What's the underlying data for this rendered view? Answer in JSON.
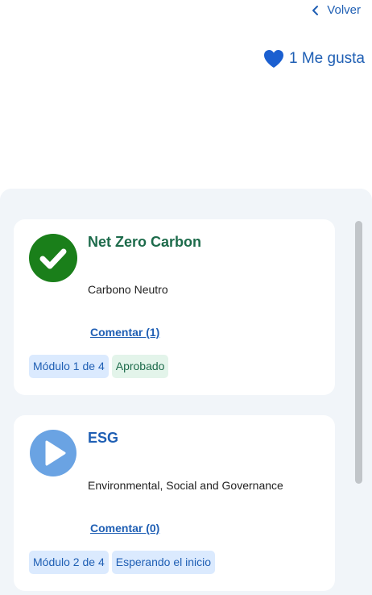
{
  "header": {
    "back_label": "Volver",
    "likes_label": "1 Me gusta"
  },
  "colors": {
    "accent": "#1f5fb4",
    "heart": "#1b5fd0",
    "done_green": "#1a7f1a",
    "play_blue": "#6aa3e3"
  },
  "modules": [
    {
      "icon": "check-circle-icon",
      "title": "Net Zero Carbon",
      "subtitle": "Carbono Neutro",
      "comment_label": "Comentar (1)",
      "module_badge": "Módulo 1 de 4",
      "status_badge": "Aprobado"
    },
    {
      "icon": "play-circle-icon",
      "title": "ESG",
      "subtitle": "Environmental, Social and Governance",
      "comment_label": "Comentar (0)",
      "module_badge": "Módulo 2 de 4",
      "status_badge": "Esperando el inicio"
    }
  ]
}
